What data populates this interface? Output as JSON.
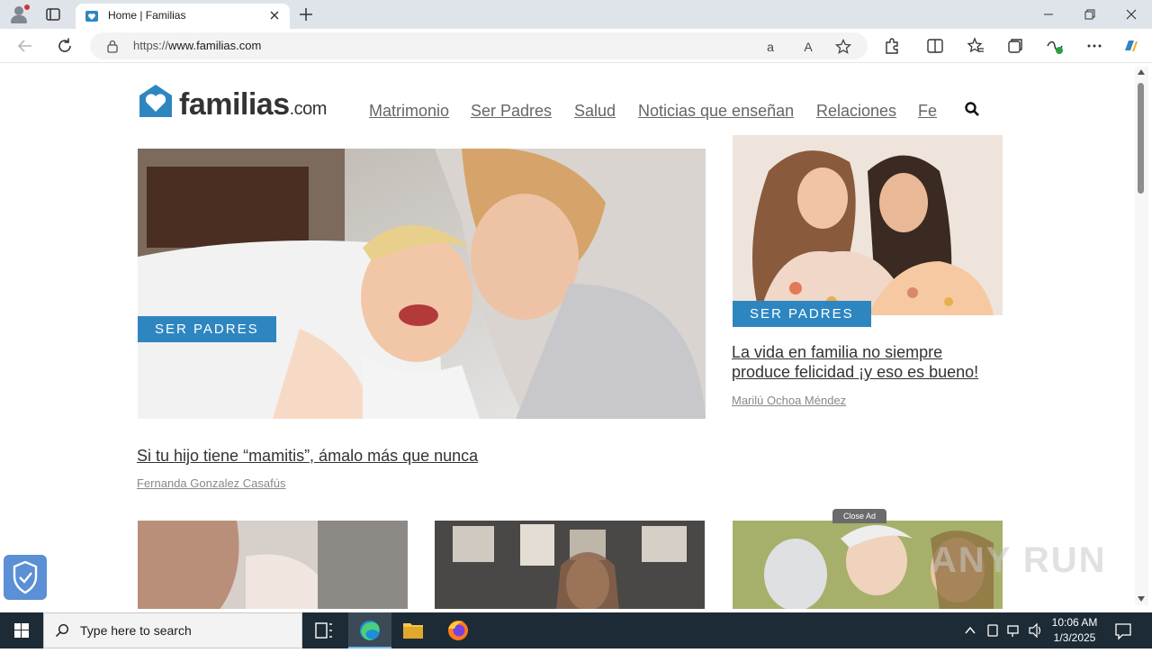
{
  "browser": {
    "tab_title": "Home | Familias",
    "url_prefix": "https://",
    "url_domain": "www.familias.com"
  },
  "site": {
    "logo_word": "familias",
    "logo_suffix": ".com",
    "nav": [
      "Matrimonio",
      "Ser Padres",
      "Salud",
      "Noticias que enseñan",
      "Relaciones",
      "Fe"
    ]
  },
  "featured": {
    "badge": "SER PADRES",
    "title": "Si tu hijo tiene “mamitis”, ámalo más que nunca",
    "author": "Fernanda Gonzalez Casafús"
  },
  "side_article": {
    "badge": "SER PADRES",
    "title": "La vida en familia no siempre produce felicidad ¡y eso es bueno!",
    "author": "Marilú Ochoa Méndez"
  },
  "ad": {
    "close_label": "Close Ad"
  },
  "watermark": "ANY RUN",
  "taskbar": {
    "search_placeholder": "Type here to search",
    "time": "10:06 AM",
    "date": "1/3/2025"
  },
  "colors": {
    "accent": "#2e86c1",
    "taskbar": "#1d2b36"
  }
}
